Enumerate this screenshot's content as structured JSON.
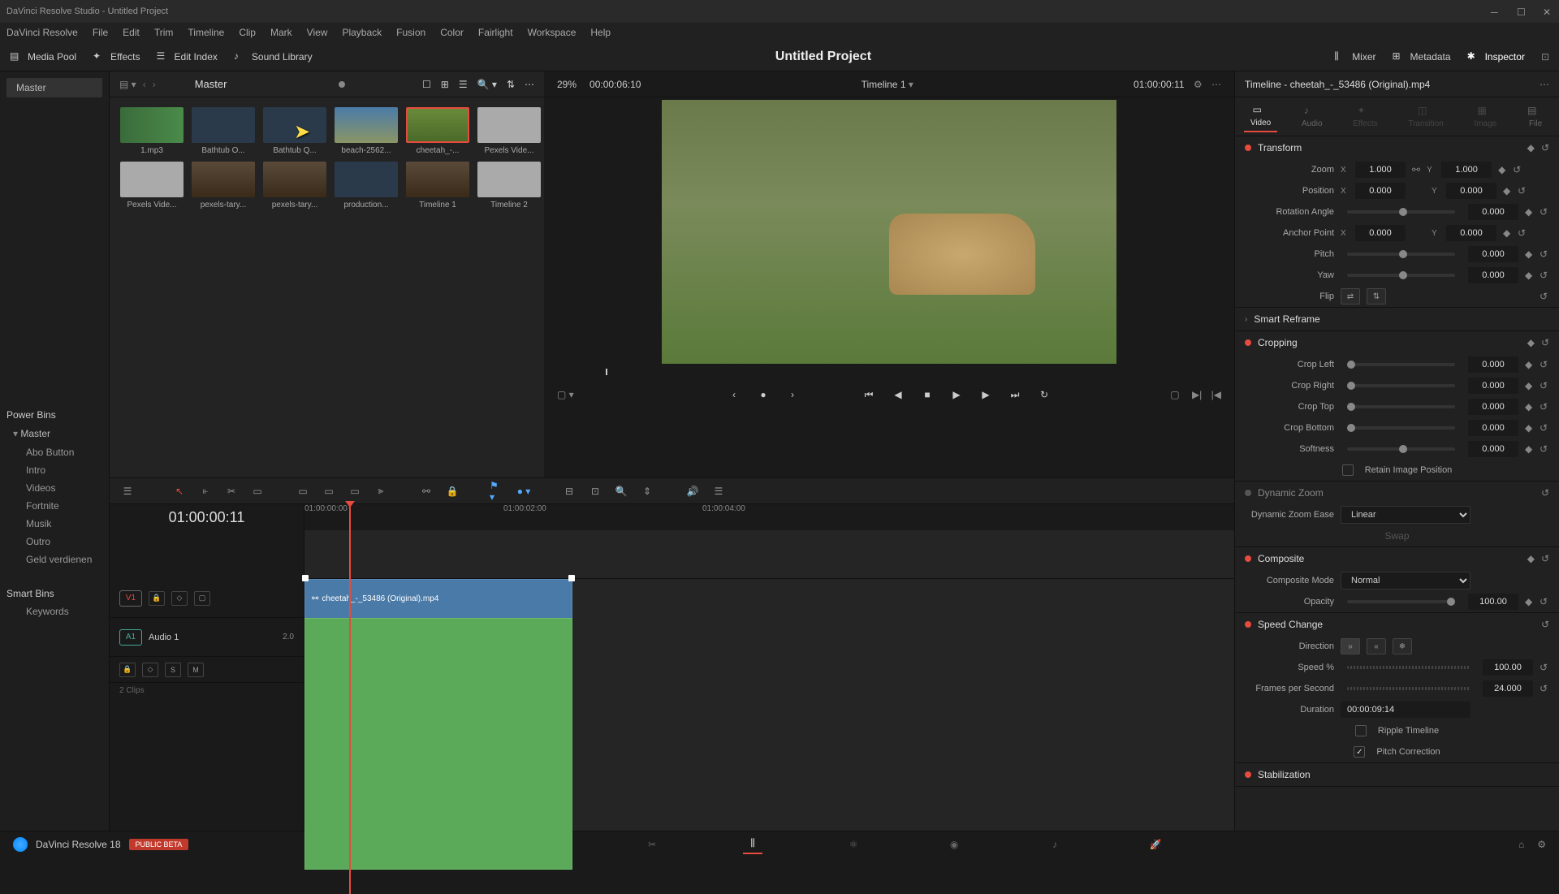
{
  "titlebar": "DaVinci Resolve Studio - Untitled Project",
  "menu": [
    "DaVinci Resolve",
    "File",
    "Edit",
    "Trim",
    "Timeline",
    "Clip",
    "Mark",
    "View",
    "Playback",
    "Fusion",
    "Color",
    "Fairlight",
    "Workspace",
    "Help"
  ],
  "toolbar": {
    "media_pool": "Media Pool",
    "effects": "Effects",
    "edit_index": "Edit Index",
    "sound_library": "Sound Library",
    "project_title": "Untitled Project",
    "mixer": "Mixer",
    "metadata": "Metadata",
    "inspector": "Inspector"
  },
  "media": {
    "master": "Master",
    "zoom": "29%",
    "duration": "00:00:06:10",
    "items": [
      {
        "label": "1.mp3",
        "class": "audio"
      },
      {
        "label": "Bathtub O...",
        "class": "dark"
      },
      {
        "label": "Bathtub Q...",
        "class": "dark"
      },
      {
        "label": "beach-2562...",
        "class": "beach"
      },
      {
        "label": "cheetah_-...",
        "class": "grass",
        "selected": true
      },
      {
        "label": "Pexels Vide...",
        "class": "light"
      },
      {
        "label": "Pexels Vide...",
        "class": "light"
      },
      {
        "label": "pexels-tary...",
        "class": "forest"
      },
      {
        "label": "pexels-tary...",
        "class": "forest"
      },
      {
        "label": "production...",
        "class": "dark"
      },
      {
        "label": "Timeline 1",
        "class": "forest"
      },
      {
        "label": "Timeline 2",
        "class": "light"
      }
    ]
  },
  "bins": {
    "master_label": "Master",
    "power_bins": "Power Bins",
    "power_master": "Master",
    "power_items": [
      "Abo Button",
      "Intro",
      "Videos",
      "Fortnite",
      "Musik",
      "Outro",
      "Geld verdienen"
    ],
    "smart_bins": "Smart Bins",
    "smart_items": [
      "Keywords"
    ]
  },
  "viewer": {
    "timeline_name": "Timeline 1",
    "timecode": "01:00:00:11"
  },
  "timeline": {
    "timecode": "01:00:00:11",
    "ruler": [
      "01:00:00:00",
      "01:00:02:00",
      "01:00:04:00"
    ],
    "v1": "V1",
    "a1": "A1",
    "audio_label": "Audio 1",
    "audio_val": "2.0",
    "clip_name": "cheetah_-_53486 (Original).mp4",
    "clips_count": "2 Clips"
  },
  "inspector": {
    "title": "Timeline - cheetah_-_53486 (Original).mp4",
    "tabs": [
      "Video",
      "Audio",
      "Effects",
      "Transition",
      "Image",
      "File"
    ],
    "transform": "Transform",
    "zoom": "Zoom",
    "zoom_x": "1.000",
    "zoom_y": "1.000",
    "position": "Position",
    "pos_x": "0.000",
    "pos_y": "0.000",
    "rotation": "Rotation Angle",
    "rotation_v": "0.000",
    "anchor": "Anchor Point",
    "anchor_x": "0.000",
    "anchor_y": "0.000",
    "pitch": "Pitch",
    "pitch_v": "0.000",
    "yaw": "Yaw",
    "yaw_v": "0.000",
    "flip": "Flip",
    "smart_reframe": "Smart Reframe",
    "cropping": "Cropping",
    "crop_left": "Crop Left",
    "crop_left_v": "0.000",
    "crop_right": "Crop Right",
    "crop_right_v": "0.000",
    "crop_top": "Crop Top",
    "crop_top_v": "0.000",
    "crop_bottom": "Crop Bottom",
    "crop_bottom_v": "0.000",
    "softness": "Softness",
    "softness_v": "0.000",
    "retain": "Retain Image Position",
    "dynamic_zoom": "Dynamic Zoom",
    "dz_ease": "Dynamic Zoom Ease",
    "dz_ease_v": "Linear",
    "dz_swap": "Swap",
    "composite": "Composite",
    "comp_mode": "Composite Mode",
    "comp_mode_v": "Normal",
    "opacity": "Opacity",
    "opacity_v": "100.00",
    "speed": "Speed Change",
    "direction": "Direction",
    "speed_pct": "Speed %",
    "speed_pct_v": "100.00",
    "fps": "Frames per Second",
    "fps_v": "24.000",
    "duration": "Duration",
    "duration_v": "00:00:09:14",
    "ripple": "Ripple Timeline",
    "pitch_corr": "Pitch Correction",
    "stabilization": "Stabilization"
  },
  "status": {
    "app": "DaVinci Resolve 18",
    "badge": "PUBLIC BETA"
  }
}
